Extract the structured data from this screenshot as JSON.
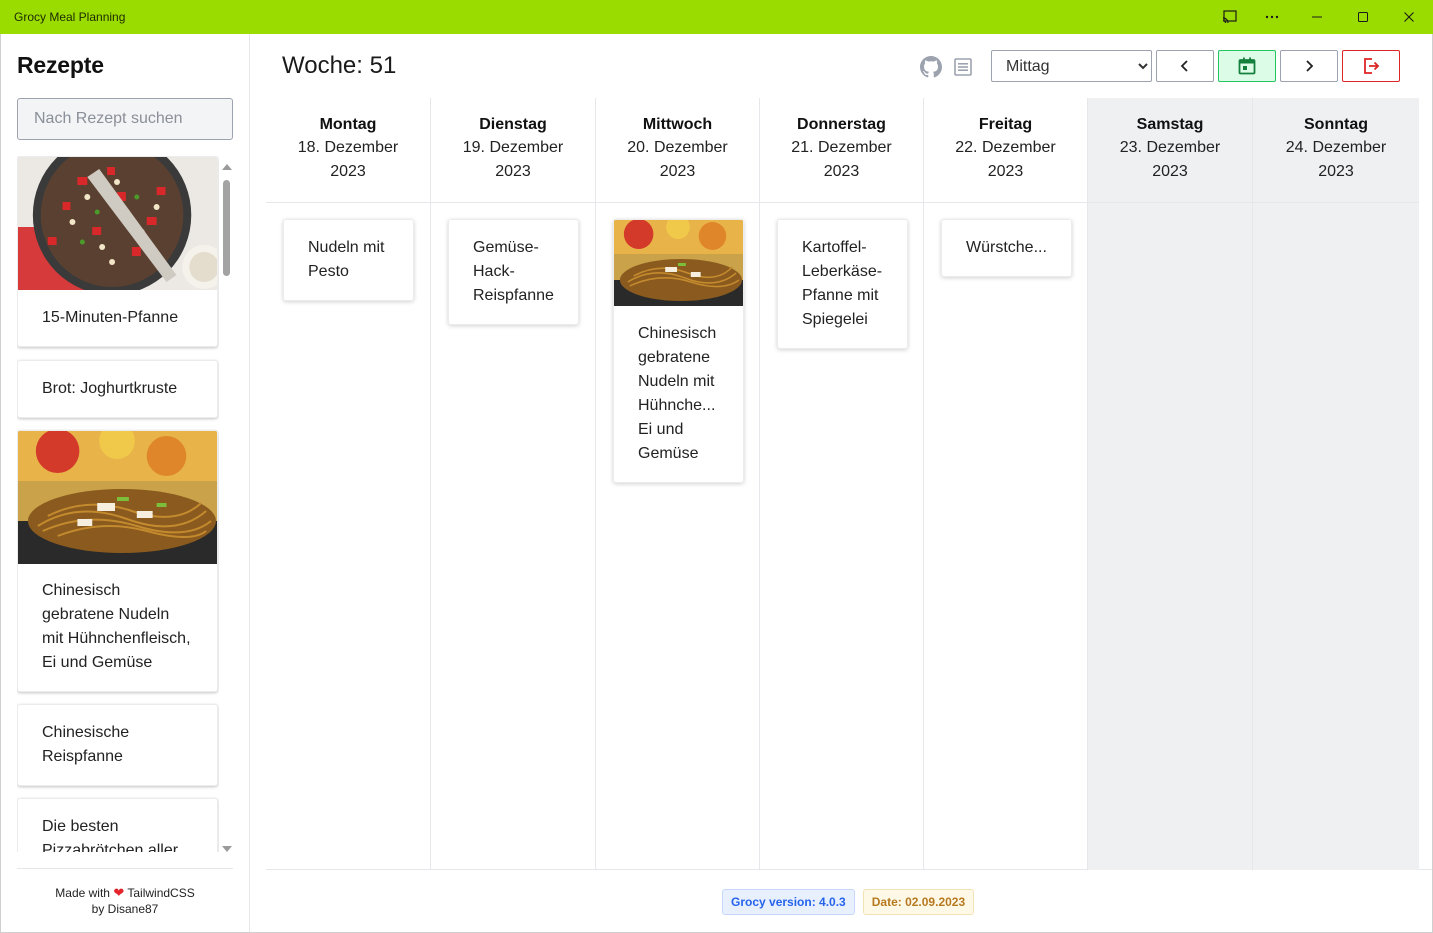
{
  "window": {
    "title": "Grocy Meal Planning"
  },
  "sidebar": {
    "title": "Rezepte",
    "search_placeholder": "Nach Rezept suchen",
    "recipes": [
      {
        "name": "15-Minuten-Pfanne",
        "image": "pan-dish"
      },
      {
        "name": "Brot: Joghurtkruste",
        "image": ""
      },
      {
        "name": "Chinesisch gebratene Nudeln mit Hühnchenfleisch, Ei und Gemüse",
        "image": "fried-noodles"
      },
      {
        "name": "Chinesische Reispfanne",
        "image": ""
      },
      {
        "name": "Die besten Pizzabrötchen aller",
        "image": ""
      }
    ],
    "footer": {
      "made_with": "Made with",
      "tech": "TailwindCSS",
      "by": "by Disane87"
    }
  },
  "header": {
    "week_label": "Woche: 51",
    "meal_select": {
      "selected": "Mittag"
    }
  },
  "days": [
    {
      "name": "Montag",
      "date": "18. Dezember",
      "year": "2023",
      "weekend": false
    },
    {
      "name": "Dienstag",
      "date": "19. Dezember",
      "year": "2023",
      "weekend": false
    },
    {
      "name": "Mittwoch",
      "date": "20. Dezember",
      "year": "2023",
      "weekend": false
    },
    {
      "name": "Donnerstag",
      "date": "21. Dezember",
      "year": "2023",
      "weekend": false
    },
    {
      "name": "Freitag",
      "date": "22. Dezember",
      "year": "2023",
      "weekend": false
    },
    {
      "name": "Samstag",
      "date": "23. Dezember",
      "year": "2023",
      "weekend": true
    },
    {
      "name": "Sonntag",
      "date": "24. Dezember",
      "year": "2023",
      "weekend": true
    }
  ],
  "meals": [
    {
      "day": "Montag",
      "lines": [
        "Nudeln mit",
        "Pesto"
      ],
      "image": ""
    },
    {
      "day": "Dienstag",
      "lines": [
        "Gemüse-",
        "Hack-",
        "Reispfanne"
      ],
      "image": ""
    },
    {
      "day": "Mittwoch",
      "lines": [
        "Chinesisch",
        "gebratene",
        "Nudeln mit",
        "Hühnche...",
        "Ei und",
        "Gemüse"
      ],
      "image": "fried-noodles"
    },
    {
      "day": "Donnerstag",
      "lines": [
        "Kartoffel-",
        "Leberkäse-",
        "Pfanne mit",
        "Spiegelei"
      ],
      "image": ""
    },
    {
      "day": "Freitag",
      "lines": [
        "Würstche..."
      ],
      "image": ""
    }
  ],
  "footer": {
    "version": "Grocy version: 4.0.3",
    "date": "Date: 02.09.2023"
  },
  "colors": {
    "titlebar": "#9bdc00",
    "today_button": "#dcfce7",
    "logout_border": "#dc2626",
    "weekend_bg": "#eef0f2"
  }
}
